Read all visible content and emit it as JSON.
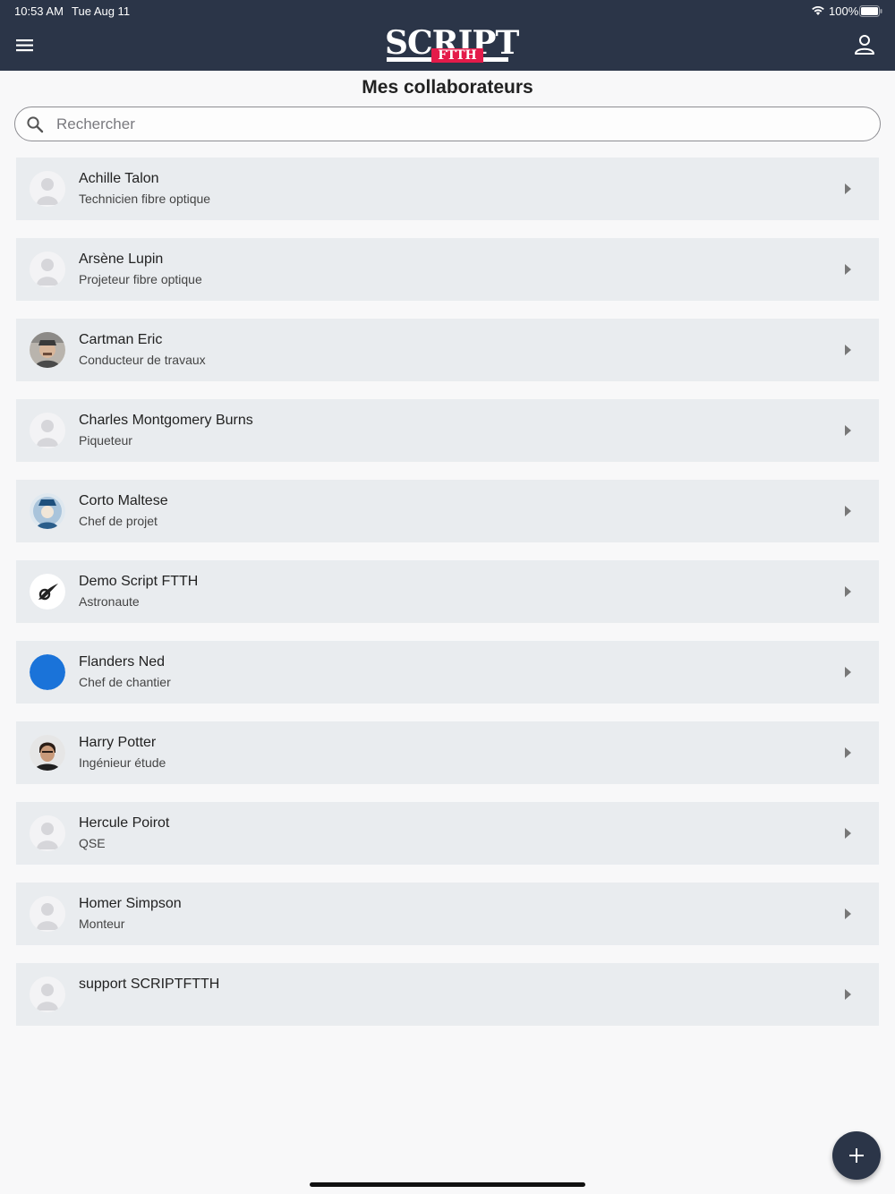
{
  "status_bar": {
    "time": "10:53 AM",
    "date": "Tue Aug 11",
    "battery": "100%"
  },
  "header": {
    "logo_main": "SCRIPT",
    "logo_sub": "FTTH",
    "menu_icon": "hamburger-menu-icon",
    "user_icon": "user-profile-icon"
  },
  "page": {
    "title": "Mes collaborateurs"
  },
  "search": {
    "placeholder": "Rechercher",
    "value": ""
  },
  "collaborators": [
    {
      "name": "Achille Talon",
      "role": "Technicien fibre optique",
      "avatar": "default-avatar-icon"
    },
    {
      "name": "Arsène Lupin",
      "role": "Projeteur fibre optique",
      "avatar": "default-avatar-icon"
    },
    {
      "name": "Cartman Eric",
      "role": "Conducteur de travaux",
      "avatar": "photo-avatar"
    },
    {
      "name": "Charles Montgomery Burns",
      "role": "Piqueteur",
      "avatar": "default-avatar-icon"
    },
    {
      "name": "Corto Maltese",
      "role": "Chef de projet",
      "avatar": "illustration-avatar"
    },
    {
      "name": "Demo Script FTTH",
      "role": "Astronaute",
      "avatar": "logo-avatar"
    },
    {
      "name": "Flanders Ned",
      "role": "Chef de chantier",
      "avatar": "blue-circle-avatar"
    },
    {
      "name": "Harry Potter",
      "role": "Ingénieur étude",
      "avatar": "photo-avatar"
    },
    {
      "name": "Hercule Poirot",
      "role": "QSE",
      "avatar": "default-avatar-icon"
    },
    {
      "name": "Homer Simpson",
      "role": "Monteur",
      "avatar": "default-avatar-icon"
    },
    {
      "name": "support SCRIPTFTTH",
      "role": "",
      "avatar": "default-avatar-icon"
    }
  ],
  "colors": {
    "header_bg": "#2b3548",
    "accent_red": "#e41b4a",
    "row_bg": "#e9ecef",
    "avatar_blue": "#1a73d9"
  },
  "fab": {
    "icon": "plus-icon"
  }
}
